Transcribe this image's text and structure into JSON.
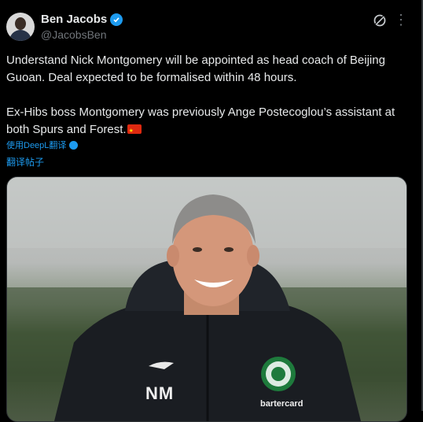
{
  "author": {
    "name": "Ben Jacobs",
    "handle": "@JacobsBen",
    "verified": true
  },
  "tweet": {
    "paragraph1": "Understand Nick Montgomery will be appointed as head coach of Beijing Guoan. Deal expected to be formalised within 48 hours.",
    "paragraph2": "Ex-Hibs boss Montgomery was previously Ange Postecoglou’s assistant at both Spurs and Forest.",
    "flag_icon": "china-flag-icon"
  },
  "actions": {
    "translate_deepl": "使用DeepL翻译",
    "translate_post": "翻译帖子"
  },
  "media": {
    "shirt_initials": "NM",
    "sponsor": "bartercard"
  },
  "icons": [
    "avatar",
    "verified-badge-icon",
    "grok-icon",
    "more-options-icon",
    "china-flag-icon",
    "deepl-icon"
  ],
  "colors": {
    "background": "#000000",
    "text": "#e7e9ea",
    "muted": "#71767b",
    "accent": "#1d9bf0"
  }
}
